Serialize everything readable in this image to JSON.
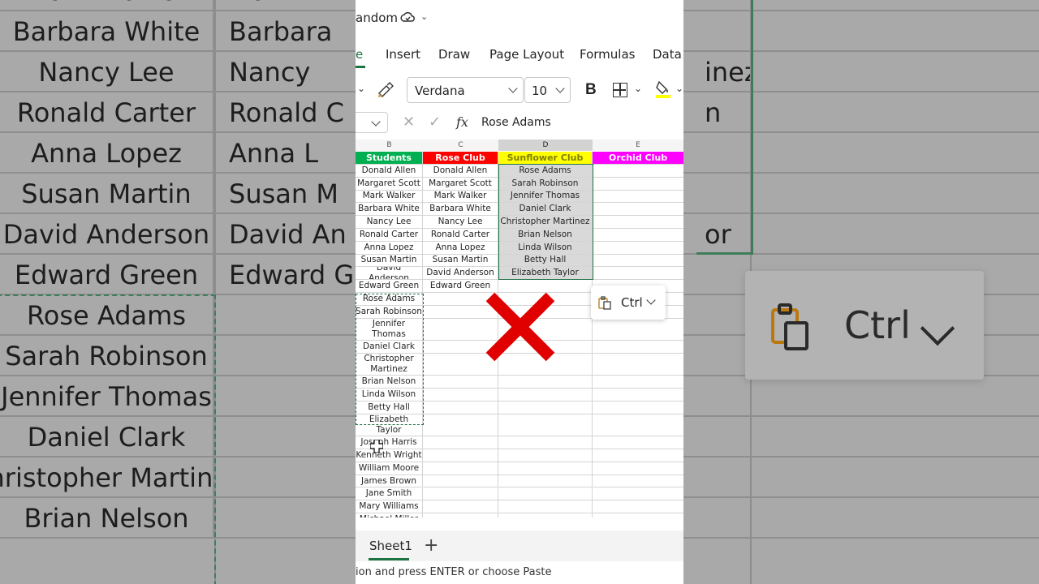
{
  "background": {
    "rows": [
      {
        "col1": "Mark Walker",
        "col2": "Mark W",
        "col3": ""
      },
      {
        "col1": "Barbara White",
        "col2": "Barbara",
        "col3": ""
      },
      {
        "col1": "Nancy Lee",
        "col2": "Nancy",
        "col3": "inez"
      },
      {
        "col1": "Ronald Carter",
        "col2": "Ronald C",
        "col3": "n"
      },
      {
        "col1": "Anna Lopez",
        "col2": "Anna L",
        "col3": ""
      },
      {
        "col1": "Susan Martin",
        "col2": "Susan M",
        "col3": ""
      },
      {
        "col1": "David Anderson",
        "col2": "David An",
        "col3": "or"
      },
      {
        "col1": "Edward Green",
        "col2": "Edward G",
        "col3": ""
      },
      {
        "col1": "Rose Adams",
        "col2": "",
        "col3": ""
      },
      {
        "col1": "Sarah Robinson",
        "col2": "",
        "col3": ""
      },
      {
        "col1": "Jennifer Thomas",
        "col2": "",
        "col3": ""
      },
      {
        "col1": "Daniel Clark",
        "col2": "",
        "col3": ""
      },
      {
        "col1": "Christopher Martinez",
        "col2": "",
        "col3": ""
      },
      {
        "col1": "Brian Nelson",
        "col2": "",
        "col3": ""
      }
    ],
    "paste_label": "Ctrl"
  },
  "title": {
    "text": "andom"
  },
  "tabs": [
    {
      "label": "e",
      "active": true
    },
    {
      "label": "Insert"
    },
    {
      "label": "Draw"
    },
    {
      "label": "Page Layout"
    },
    {
      "label": "Formulas"
    },
    {
      "label": "Data"
    }
  ],
  "ribbon": {
    "font": "Verdana",
    "size": "10",
    "bold": "B"
  },
  "formula_bar": {
    "value": "Rose Adams"
  },
  "columns": {
    "b": "B",
    "c": "C",
    "d": "D",
    "e": "E"
  },
  "headers": {
    "b": {
      "label": "Students",
      "bg": "#00b050",
      "fg": "#ffffff"
    },
    "c": {
      "label": "Rose Club",
      "bg": "#ff0000",
      "fg": "#ffffff"
    },
    "d": {
      "label": "Sunflower Club",
      "bg": "#ffff00",
      "fg": "#7f7f00"
    },
    "e": {
      "label": "Orchid Club",
      "bg": "#ff00ff",
      "fg": "#ffffff"
    }
  },
  "rows": [
    {
      "b": "Donald Allen",
      "c": "Donald Allen",
      "d": "Rose Adams"
    },
    {
      "b": "Margaret Scott",
      "c": "Margaret Scott",
      "d": "Sarah Robinson"
    },
    {
      "b": "Mark Walker",
      "c": "Mark Walker",
      "d": "Jennifer Thomas"
    },
    {
      "b": "Barbara White",
      "c": "Barbara White",
      "d": "Daniel Clark"
    },
    {
      "b": "Nancy Lee",
      "c": "Nancy Lee",
      "d": "Christopher Martinez"
    },
    {
      "b": "Ronald Carter",
      "c": "Ronald Carter",
      "d": "Brian Nelson"
    },
    {
      "b": "Anna Lopez",
      "c": "Anna Lopez",
      "d": "Linda Wilson"
    },
    {
      "b": "Susan Martin",
      "c": "Susan Martin",
      "d": "Betty Hall"
    },
    {
      "b": "David Anderson",
      "c": "David Anderson",
      "d": "Elizabeth Taylor"
    },
    {
      "b": "Edward Green",
      "c": "Edward Green",
      "d": ""
    },
    {
      "b": "Rose Adams",
      "c": "",
      "d": ""
    },
    {
      "b": "Sarah Robinson",
      "c": "",
      "d": ""
    },
    {
      "b": "Jennifer Thomas",
      "c": "",
      "d": ""
    },
    {
      "b": "Daniel Clark",
      "c": "",
      "d": ""
    },
    {
      "b": "Christopher Martinez",
      "c": "",
      "d": ""
    },
    {
      "b": "Brian Nelson",
      "c": "",
      "d": ""
    },
    {
      "b": "Linda Wilson",
      "c": "",
      "d": ""
    },
    {
      "b": "Betty Hall",
      "c": "",
      "d": ""
    },
    {
      "b": "Elizabeth Taylor",
      "c": "",
      "d": ""
    },
    {
      "b": "Joseph Harris",
      "c": "",
      "d": ""
    },
    {
      "b": "Kenneth Wright",
      "c": "",
      "d": ""
    },
    {
      "b": "William Moore",
      "c": "",
      "d": ""
    },
    {
      "b": "James Brown",
      "c": "",
      "d": ""
    },
    {
      "b": "Jane Smith",
      "c": "",
      "d": ""
    },
    {
      "b": "Mary Williams",
      "c": "",
      "d": ""
    },
    {
      "b": "Michael Miller",
      "c": "",
      "d": ""
    }
  ],
  "paste_options": {
    "label": "Ctrl"
  },
  "sheet": {
    "tab": "Sheet1",
    "add": "+"
  },
  "status": {
    "text": "ion and press ENTER or choose Paste"
  }
}
